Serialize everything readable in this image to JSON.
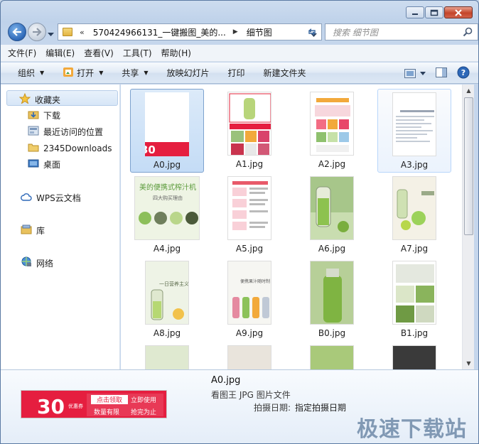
{
  "window": {
    "title_hidden": "",
    "accent": "#2d68b8"
  },
  "address": {
    "overflow": "«",
    "crumb1": "570424966131_一键搬图_美的...",
    "crumb2": "细节图"
  },
  "search": {
    "placeholder": "搜索 细节图"
  },
  "menu": {
    "file": "文件(F)",
    "edit": "编辑(E)",
    "view": "查看(V)",
    "tools": "工具(T)",
    "help": "帮助(H)"
  },
  "toolbar": {
    "organize": "组织",
    "open": "打开",
    "share": "共享",
    "slideshow": "放映幻灯片",
    "print": "打印",
    "new_folder": "新建文件夹"
  },
  "nav": {
    "favorites": "收藏夹",
    "downloads": "下载",
    "recent": "最近访问的位置",
    "downloads2345": "2345Downloads",
    "desktop": "桌面",
    "wps": "WPS云文档",
    "library": "库",
    "network": "网络"
  },
  "files": [
    {
      "name": "A0.jpg",
      "state": "selected"
    },
    {
      "name": "A1.jpg",
      "state": "normal"
    },
    {
      "name": "A2.jpg",
      "state": "normal"
    },
    {
      "name": "A3.jpg",
      "state": "hover"
    },
    {
      "name": "A4.jpg",
      "state": "normal"
    },
    {
      "name": "A5.jpg",
      "state": "normal"
    },
    {
      "name": "A6.jpg",
      "state": "normal"
    },
    {
      "name": "A7.jpg",
      "state": "normal"
    },
    {
      "name": "A8.jpg",
      "state": "normal"
    },
    {
      "name": "A9.jpg",
      "state": "normal"
    },
    {
      "name": "B0.jpg",
      "state": "normal"
    },
    {
      "name": "B1.jpg",
      "state": "normal"
    }
  ],
  "thumb_text": {
    "a0_num": "30",
    "a0_badge1": "点击领取",
    "a0_badge2": "立即使用",
    "a4_title": "美的便携式榨汁机",
    "a4_sub": "四大购买理由",
    "a8_title": "一日营养主义",
    "a9_title": "便携果汁随时制"
  },
  "details": {
    "name": "A0.jpg",
    "type": "看图王 JPG 图片文件",
    "prop_label": "拍摄日期:",
    "prop_value": "指定拍摄日期",
    "banner_num": "30",
    "banner_pre": "优惠券",
    "banner_claim": "点击领取",
    "banner_use": "立即使用",
    "banner_limit": "数量有限",
    "banner_grab": "抢完为止"
  },
  "watermark": "极速下载站"
}
